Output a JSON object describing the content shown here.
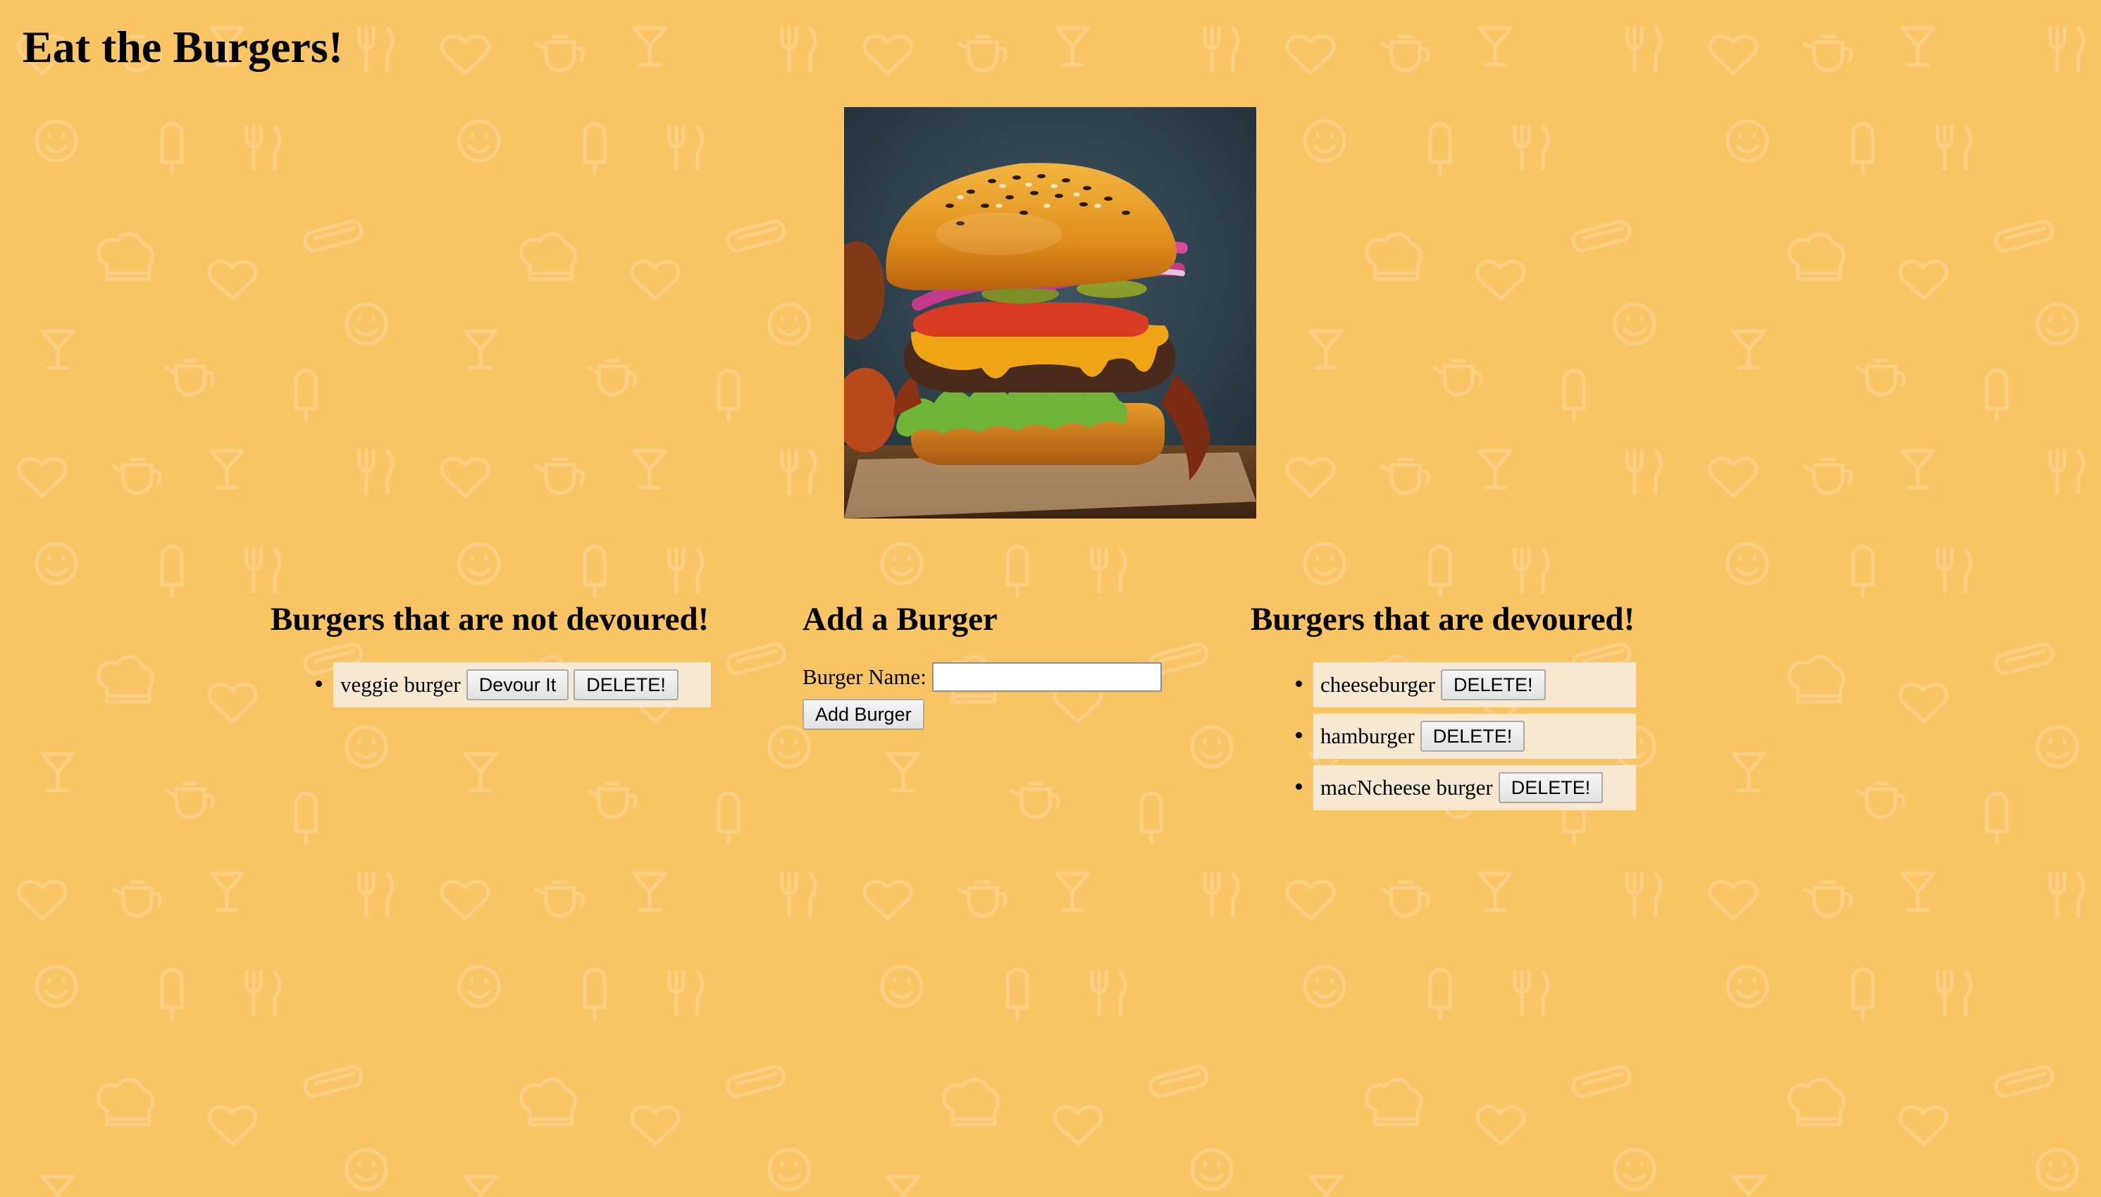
{
  "header": {
    "title": "Eat the Burgers!"
  },
  "hero_image": {
    "icon": "burger-photo"
  },
  "not_devoured": {
    "title": "Burgers that are not devoured!",
    "items": [
      {
        "name": "veggie burger",
        "devour_label": "Devour It",
        "delete_label": "DELETE!"
      }
    ]
  },
  "add_burger": {
    "title": "Add a Burger",
    "field_label": "Burger Name:",
    "field_value": "",
    "button_label": "Add Burger"
  },
  "devoured": {
    "title": "Burgers that are devoured!",
    "items": [
      {
        "name": "cheeseburger",
        "delete_label": "DELETE!"
      },
      {
        "name": "hamburger",
        "delete_label": "DELETE!"
      },
      {
        "name": "macNcheese burger",
        "delete_label": "DELETE!"
      }
    ]
  },
  "colors": {
    "background": "#f9c564",
    "pattern": "#fbd186",
    "item_background": "#f7e8d2"
  }
}
